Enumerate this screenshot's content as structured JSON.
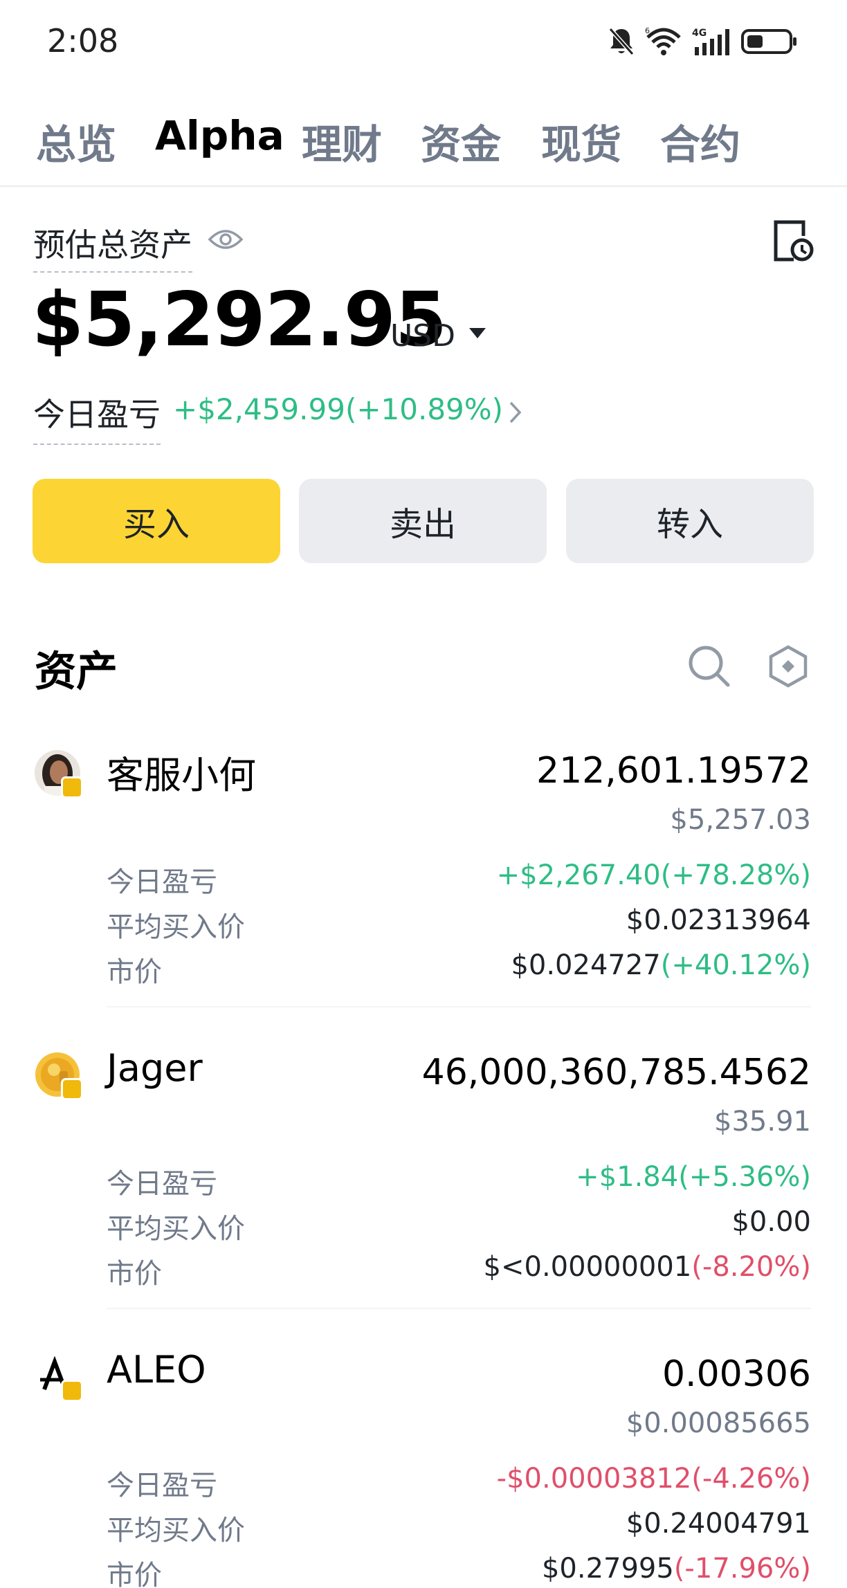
{
  "status_bar": {
    "time": "2:08",
    "icons": [
      "mute-bell-icon",
      "wifi-6-icon",
      "signal-4g-icon",
      "battery-icon"
    ],
    "wifi_badge": "6",
    "network_badge": "4G"
  },
  "top_tabs": {
    "items": [
      {
        "label": "总览",
        "active": false
      },
      {
        "label": "Alpha",
        "active": true
      },
      {
        "label": "理财",
        "active": false
      },
      {
        "label": "资金",
        "active": false
      },
      {
        "label": "现货",
        "active": false
      },
      {
        "label": "合约",
        "active": false
      }
    ]
  },
  "summary": {
    "estimated_label": "预估总资产",
    "total": "$5,292.95",
    "currency": "USD",
    "pnl_label": "今日盈亏",
    "pnl_value": "+$2,459.99(+10.89%)"
  },
  "actions": {
    "buy": "买入",
    "sell": "卖出",
    "transfer": "转入"
  },
  "assets": {
    "title": "资产",
    "labels": {
      "pnl": "今日盈亏",
      "avg_price": "平均买入价",
      "market_price": "市价"
    },
    "items": [
      {
        "name": "客服小何",
        "quantity": "212,601.19572",
        "usd_value": "$5,257.03",
        "pnl": "+$2,267.40(+78.28%)",
        "avg_price": "$0.02313964",
        "market_price": "$0.024727",
        "market_change": "(+40.12%)"
      },
      {
        "name": "Jager",
        "quantity": "46,000,360,785.4562",
        "usd_value": "$35.91",
        "pnl": "+$1.84(+5.36%)",
        "avg_price": "$0.00",
        "market_price": "$<0.00000001",
        "market_change": "(-8.20%)"
      },
      {
        "name": "ALEO",
        "quantity": "0.00306",
        "usd_value": "$0.00085665",
        "pnl": "-$0.00003812(-4.26%)",
        "avg_price": "$0.24004791",
        "market_price": "$0.27995",
        "market_change": "(-17.96%)"
      }
    ]
  },
  "colors": {
    "up": "#2ebd85",
    "down": "#e04f6a",
    "accent": "#fcd535",
    "secondary_button": "#eaecef"
  }
}
